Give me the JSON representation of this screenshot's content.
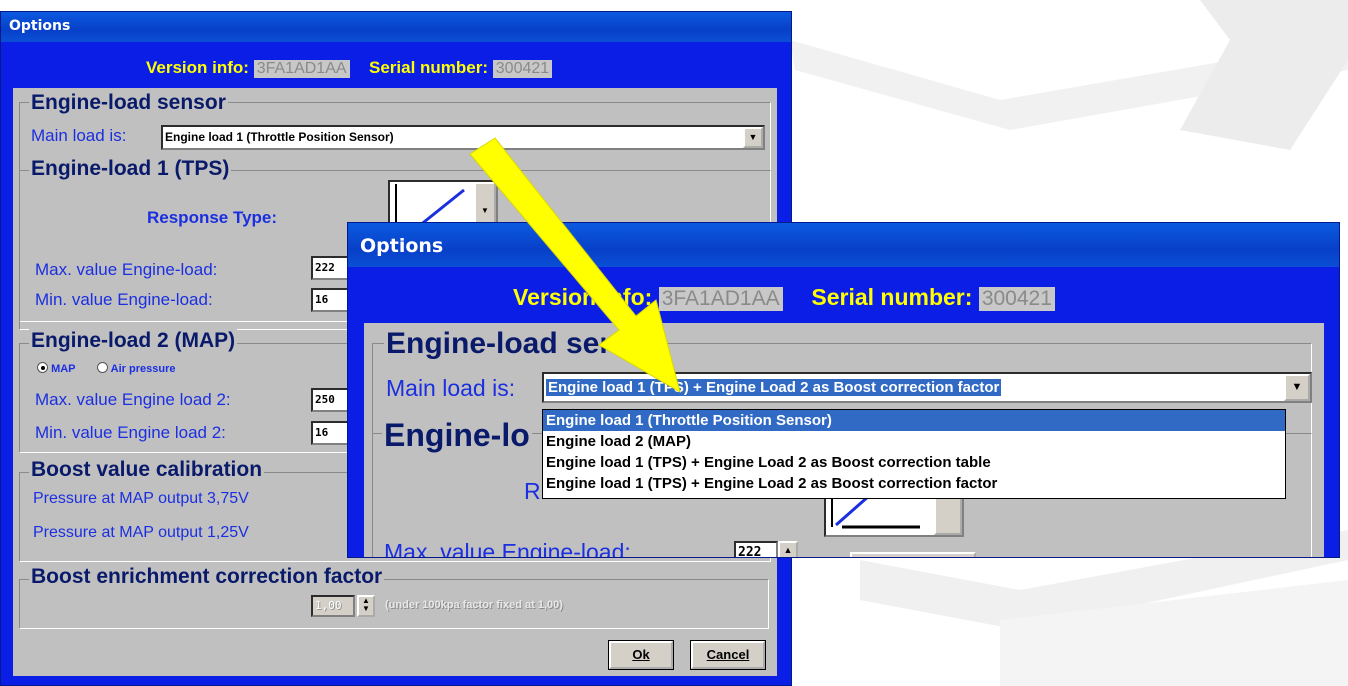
{
  "window_title": "Options",
  "version_label": "Version info:",
  "version_value": "3FA1AD1AA",
  "serial_label": "Serial number:",
  "serial_value": "300421",
  "engine_load_sensor_heading": "Engine-load sensor",
  "main_load_label": "Main load is:",
  "back": {
    "main_load_value": "Engine load 1 (Throttle Position Sensor)",
    "el1_heading": "Engine-load 1 (TPS)",
    "response_type_label": "Response Type:",
    "max_el_label": "Max. value Engine-load:",
    "max_el_value": "222",
    "min_el_label": "Min. value Engine-load:",
    "min_el_value": "16",
    "el2_heading": "Engine-load 2 (MAP)",
    "radio_map": "MAP",
    "radio_air": "Air pressure",
    "max_el2_label": "Max. value Engine load 2:",
    "max_el2_value": "250",
    "min_el2_label": "Min.  value Engine load 2:",
    "min_el2_value": "16",
    "boost_cal_heading": "Boost value calibration",
    "pressure_375": "Pressure at MAP output 3,75V",
    "pressure_125": "Pressure at MAP output 1,25V",
    "boost_enrich_heading": "Boost enrichment correction factor",
    "factor_value": "1,00",
    "factor_note": "(under 100kpa factor fixed at 1,00)",
    "ok_label": "Ok",
    "cancel_label": "Cancel"
  },
  "front": {
    "main_load_value": "Engine load 1 (TPS) + Engine Load 2 as Boost correction factor",
    "el1_heading_partial": "Engine-lo",
    "response_partial": "R",
    "max_el_label": "Max. value Engine-load:",
    "max_el_value": "222",
    "dropdown_options": [
      "Engine load 1 (Throttle Position Sensor)",
      "Engine load 2 (MAP)",
      "Engine load 1 (TPS) + Engine Load 2 as Boost correction table",
      "Engine load 1 (TPS) + Engine Load 2 as Boost correction factor"
    ],
    "selected_index": 0
  },
  "colors": {
    "window_bg": "#0b1ee6",
    "title_bar": "#0840c8",
    "yellow_text": "#ffff00",
    "label_blue": "#1b2fe0",
    "arrow": "#ffff00",
    "selection": "#316ac5"
  }
}
